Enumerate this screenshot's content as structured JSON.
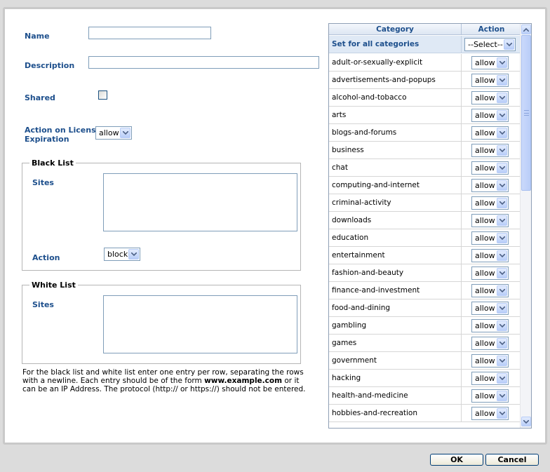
{
  "form": {
    "name_label": "Name",
    "name_value": "",
    "description_label": "Description",
    "description_value": "",
    "shared_label": "Shared",
    "shared_checked": false,
    "license_label_line1": "Action on License",
    "license_label_line2": "Expiration",
    "license_value": "allow"
  },
  "black_list": {
    "title": "Black List",
    "sites_label": "Sites",
    "sites_value": "",
    "action_label": "Action",
    "action_value": "block"
  },
  "white_list": {
    "title": "White List",
    "sites_label": "Sites",
    "sites_value": ""
  },
  "help": {
    "part1": "For the black list and white list enter one entry per row, separating the rows with a newline. Each entry should be of the form ",
    "example": "www.example.com",
    "part2": " or it can be an IP Address. The protocol (http:// or https://) should not be entered."
  },
  "categories": {
    "header_category": "Category",
    "header_action": "Action",
    "set_all_label": "Set for all categories",
    "set_all_value": "--Select--",
    "rows": [
      {
        "name": "adult-or-sexually-explicit",
        "action": "allow"
      },
      {
        "name": "advertisements-and-popups",
        "action": "allow"
      },
      {
        "name": "alcohol-and-tobacco",
        "action": "allow"
      },
      {
        "name": "arts",
        "action": "allow"
      },
      {
        "name": "blogs-and-forums",
        "action": "allow"
      },
      {
        "name": "business",
        "action": "allow"
      },
      {
        "name": "chat",
        "action": "allow"
      },
      {
        "name": "computing-and-internet",
        "action": "allow"
      },
      {
        "name": "criminal-activity",
        "action": "allow"
      },
      {
        "name": "downloads",
        "action": "allow"
      },
      {
        "name": "education",
        "action": "allow"
      },
      {
        "name": "entertainment",
        "action": "allow"
      },
      {
        "name": "fashion-and-beauty",
        "action": "allow"
      },
      {
        "name": "finance-and-investment",
        "action": "allow"
      },
      {
        "name": "food-and-dining",
        "action": "allow"
      },
      {
        "name": "gambling",
        "action": "allow"
      },
      {
        "name": "games",
        "action": "allow"
      },
      {
        "name": "government",
        "action": "allow"
      },
      {
        "name": "hacking",
        "action": "allow"
      },
      {
        "name": "health-and-medicine",
        "action": "allow"
      },
      {
        "name": "hobbies-and-recreation",
        "action": "allow"
      }
    ]
  },
  "buttons": {
    "ok_label": "OK",
    "cancel_label": "Cancel"
  },
  "colors": {
    "label_blue": "#1d4f8c",
    "panel_border": "#c9c9c9",
    "header_bg": "#dde6f2"
  }
}
